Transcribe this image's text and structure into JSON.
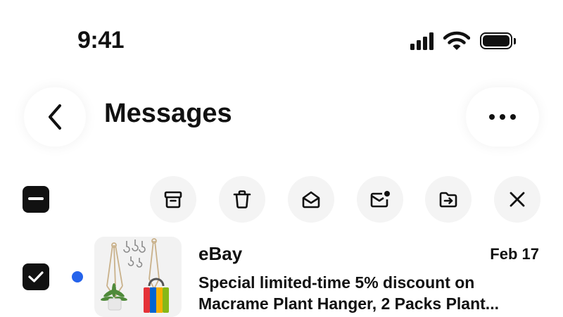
{
  "status_bar": {
    "time": "9:41",
    "icons": [
      "cellular-signal-icon",
      "wifi-icon",
      "battery-icon"
    ]
  },
  "header": {
    "title": "Messages",
    "back_icon": "chevron-left-icon",
    "more_icon": "more-horizontal-icon"
  },
  "toolbar": {
    "select_all_icon": "minus-checkbox-icon",
    "actions": [
      "archive-icon",
      "trash-icon",
      "mail-open-icon",
      "mail-unread-icon",
      "folder-move-icon",
      "close-icon"
    ]
  },
  "messages": [
    {
      "sender": "eBay",
      "date": "Feb 17",
      "subject_line1": "Special limited-time 5% discount on",
      "subject_line2": "Macrame Plant Hanger, 2 Packs Plant...",
      "checked": true,
      "unread": true,
      "thumbnail": "macrame-plant-hanger-image"
    }
  ],
  "colors": {
    "accent_blue": "#2563eb",
    "text": "#111111",
    "button_bg": "#f4f4f4"
  }
}
